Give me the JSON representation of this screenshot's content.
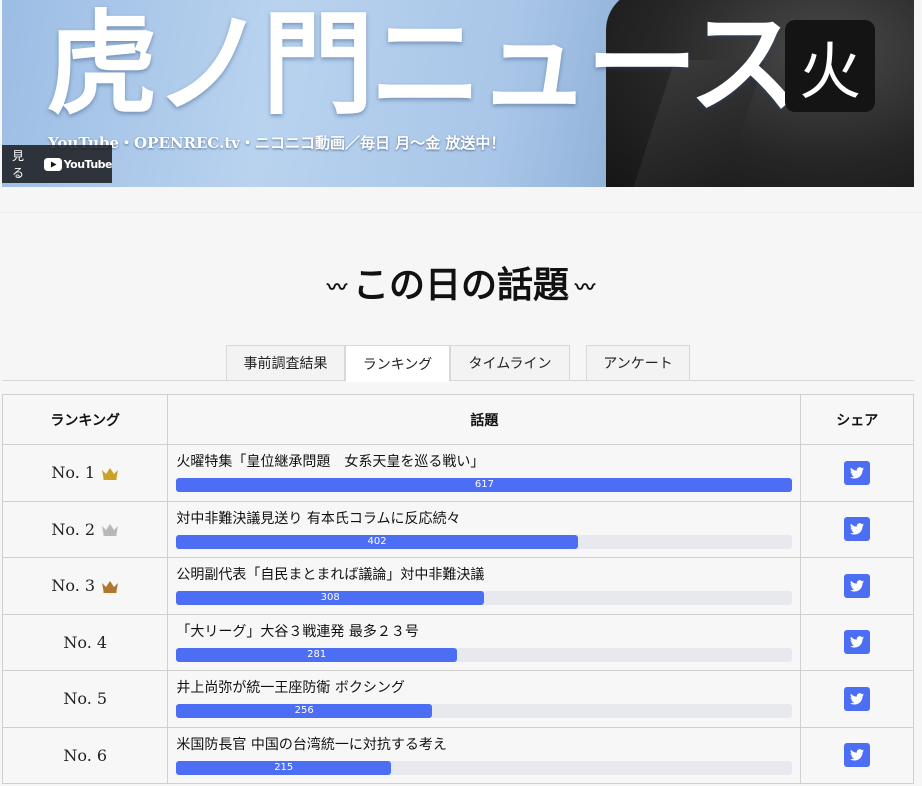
{
  "banner": {
    "title": "虎ノ門ニュース",
    "subtitle": "YouTube・OPENREC.tv・ニコニコ動画／毎日 月～金 放送中！",
    "day_badge": "火",
    "watch_label": "見る",
    "youtube_label": "YouTube"
  },
  "section": {
    "title": "この日の話題",
    "wave": "〰"
  },
  "tabs": [
    {
      "label": "事前調査結果",
      "active": false
    },
    {
      "label": "ランキング",
      "active": true
    },
    {
      "label": "タイムライン",
      "active": false
    },
    {
      "label": "アンケート",
      "active": false
    }
  ],
  "table": {
    "headers": {
      "rank": "ランキング",
      "topic": "話題",
      "share": "シェア"
    },
    "max_value": 617,
    "rows": [
      {
        "rank": "No. 1",
        "crown": "gold",
        "topic": "火曜特集「皇位継承問題　女系天皇を巡る戦い」",
        "value": 617
      },
      {
        "rank": "No. 2",
        "crown": "silver",
        "topic": "対中非難決議見送り 有本氏コラムに反応続々",
        "value": 402
      },
      {
        "rank": "No. 3",
        "crown": "bronze",
        "topic": "公明副代表「自民まとまれば議論」対中非難決議",
        "value": 308
      },
      {
        "rank": "No. 4",
        "crown": null,
        "topic": "「大リーグ」大谷３戦連発 最多２３号",
        "value": 281
      },
      {
        "rank": "No. 5",
        "crown": null,
        "topic": "井上尚弥が統一王座防衛 ボクシング",
        "value": 256
      },
      {
        "rank": "No. 6",
        "crown": null,
        "topic": "米国防長官 中国の台湾統一に対抗する考え",
        "value": 215
      }
    ]
  },
  "colors": {
    "accent": "#4c6ef5",
    "crown_gold": "#c9a227",
    "crown_silver": "#b8b8b8",
    "crown_bronze": "#b0772e"
  },
  "icons": {
    "crown": "crown-icon",
    "share": "twitter-icon",
    "youtube": "youtube-play-icon"
  }
}
